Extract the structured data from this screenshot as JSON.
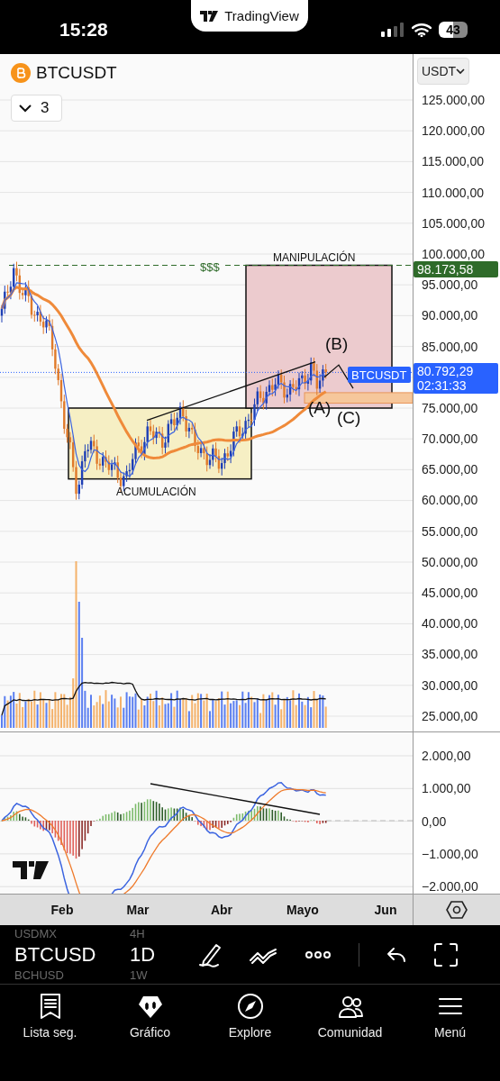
{
  "status_bar": {
    "time": "15:28",
    "battery": "43"
  },
  "app_pill": {
    "name": "TradingView"
  },
  "chart": {
    "symbol": "BTCUSDT",
    "indicators_button": "3",
    "currency": "USDT",
    "price_axis_upper": [
      "125.000,00",
      "120.000,00",
      "115.000,00",
      "110.000,00",
      "105.000,00",
      "100.000,00",
      "95.000,00",
      "90.000,00",
      "85.000,00"
    ],
    "price_axis_lower": [
      "75.000,00",
      "70.000,00",
      "65.000,00",
      "60.000,00",
      "55.000,00",
      "50.000,00",
      "45.000,00",
      "40.000,00",
      "35.000,00",
      "30.000,00",
      "25.000,00"
    ],
    "annotations": [
      {
        "kind": "manipulation",
        "text": "MANIPULACIÓN"
      },
      {
        "kind": "liquidity",
        "text": "$$$"
      },
      {
        "kind": "wave_b",
        "text": "(B)"
      },
      {
        "kind": "wave_a",
        "text": "(A)"
      },
      {
        "kind": "wave_c",
        "text": "(C)"
      },
      {
        "kind": "accumulation",
        "text": "ACUMULACIÓN"
      }
    ],
    "alert_tag": {
      "price": "98.173,58",
      "color": "#2f6b2a"
    },
    "last_price_tag": {
      "symbol": "BTCUSDT",
      "price": "80.792,29",
      "countdown": "02:31:33",
      "color": "#2962ff"
    },
    "macd_axis": [
      "2.000,00",
      "1.000,00",
      "0,00",
      "−1.000,00",
      "−2.000,00"
    ],
    "time_axis": [
      "Feb",
      "Mar",
      "Abr",
      "Mayo",
      "Jun"
    ]
  },
  "toolbar": {
    "symbol_picker": [
      {
        "symbol": "USDMX",
        "interval": "4H",
        "selected": false
      },
      {
        "symbol": "BTCUSD",
        "interval": "1D",
        "selected": true
      },
      {
        "symbol": "BCHUSD",
        "interval": "1W",
        "selected": false
      }
    ]
  },
  "nav": [
    {
      "kind": "watchlist",
      "label": "Lista seg."
    },
    {
      "kind": "chart",
      "label": "Gráfico"
    },
    {
      "kind": "explore",
      "label": "Explore"
    },
    {
      "kind": "community",
      "label": "Comunidad"
    },
    {
      "kind": "menu",
      "label": "Menú"
    }
  ]
}
